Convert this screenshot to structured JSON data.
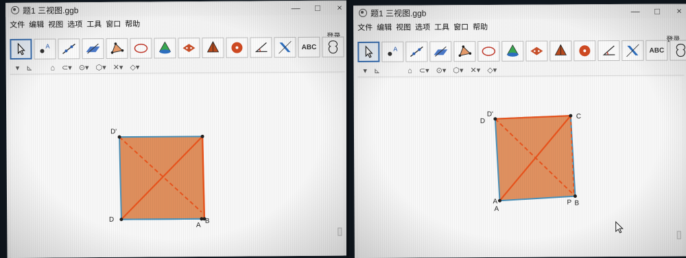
{
  "colors": {
    "face": "#d9773a",
    "edge": "#e8541d",
    "frame": "#4a90b8",
    "toolbar_active": "#3a6fb0"
  },
  "screenshots": [
    {
      "window": {
        "title": "题1 三视图.ggb",
        "controls": [
          "—",
          "□",
          "×"
        ]
      },
      "menu": [
        "文件",
        "编辑",
        "视图",
        "选项",
        "工具",
        "窗口",
        "帮助"
      ],
      "login": "登录",
      "toolbar": [
        {
          "icon": "move-icon"
        },
        {
          "icon": "point-icon"
        },
        {
          "icon": "line-icon"
        },
        {
          "icon": "plane-icon"
        },
        {
          "icon": "polygon-icon"
        },
        {
          "icon": "circle-icon"
        },
        {
          "icon": "pyramid-icon"
        },
        {
          "icon": "net-icon"
        },
        {
          "icon": "prism-icon"
        },
        {
          "icon": "sphere-icon"
        },
        {
          "icon": "angle-icon"
        },
        {
          "icon": "reflect-icon"
        },
        {
          "icon": "text-icon",
          "label": "ABC"
        },
        {
          "icon": "rotate-view-icon"
        }
      ],
      "labels": {
        "Dp": "D'",
        "D": "D",
        "A": "A",
        "B": "B"
      }
    },
    {
      "window": {
        "title": "题1 三视图.ggb",
        "controls": [
          "—",
          "□",
          "×"
        ]
      },
      "menu": [
        "文件",
        "编辑",
        "视图",
        "选项",
        "工具",
        "窗口",
        "帮助"
      ],
      "login": "登录",
      "toolbar": [
        {
          "icon": "move-icon"
        },
        {
          "icon": "point-icon"
        },
        {
          "icon": "line-icon"
        },
        {
          "icon": "plane-icon"
        },
        {
          "icon": "polygon-icon"
        },
        {
          "icon": "circle-icon"
        },
        {
          "icon": "pyramid-icon"
        },
        {
          "icon": "net-icon"
        },
        {
          "icon": "prism-icon"
        },
        {
          "icon": "sphere-icon"
        },
        {
          "icon": "angle-icon"
        },
        {
          "icon": "reflect-icon"
        },
        {
          "icon": "text-icon",
          "label": "ABC"
        },
        {
          "icon": "rotate-view-icon"
        }
      ],
      "labels": {
        "Dp": "D'",
        "D": "D",
        "C": "C",
        "A": "A",
        "Ap": "A",
        "B": "B",
        "P": "P"
      }
    }
  ]
}
